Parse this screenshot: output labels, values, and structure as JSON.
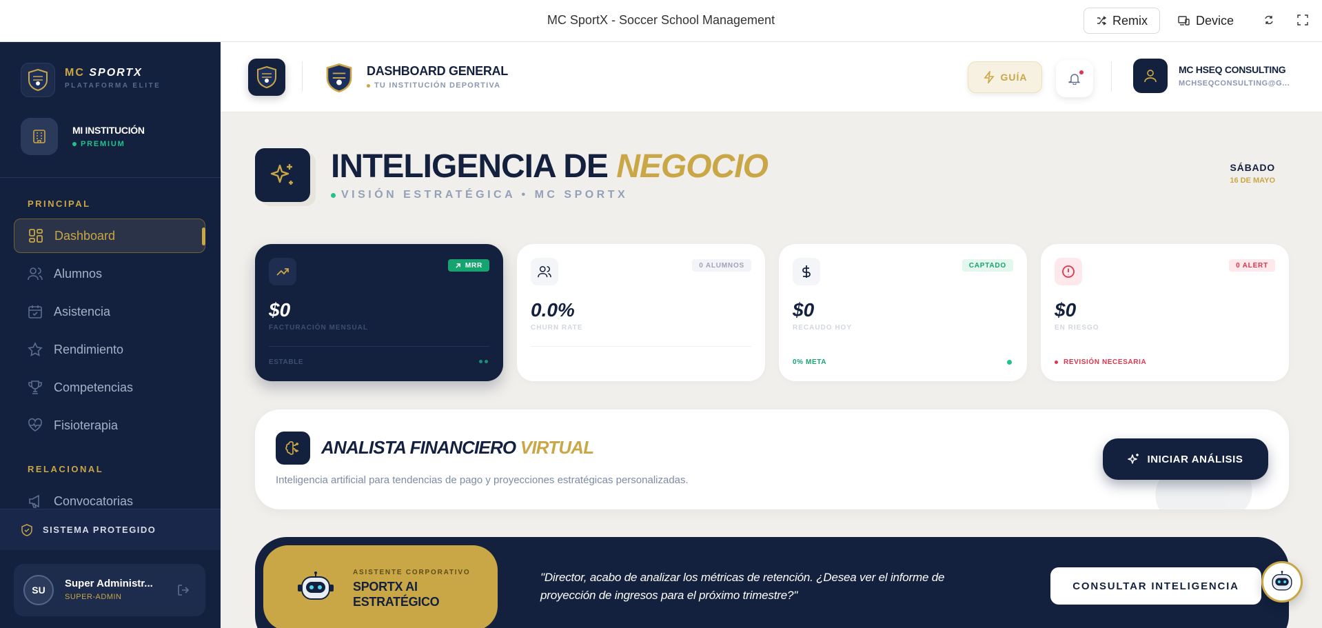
{
  "window": {
    "title": "MC SportX - Soccer School Management",
    "remix_label": "Remix",
    "device_label": "Device"
  },
  "sidebar": {
    "brand_first": "MC",
    "brand_second": "SPORTX",
    "brand_subtitle": "PLATAFORMA ELITE",
    "institution_name": "MI INSTITUCIÓN",
    "institution_tier": "PREMIUM",
    "sections": [
      {
        "label": "PRINCIPAL"
      },
      {
        "label": "RELACIONAL"
      }
    ],
    "items": [
      {
        "label": "Dashboard",
        "icon": "dashboard-icon",
        "active": true
      },
      {
        "label": "Alumnos",
        "icon": "users-icon"
      },
      {
        "label": "Asistencia",
        "icon": "calendar-check-icon"
      },
      {
        "label": "Rendimiento",
        "icon": "star-icon"
      },
      {
        "label": "Competencias",
        "icon": "trophy-icon"
      },
      {
        "label": "Fisioterapia",
        "icon": "heart-pulse-icon"
      },
      {
        "label": "Convocatorias",
        "icon": "megaphone-icon"
      }
    ],
    "protected_label": "SISTEMA PROTEGIDO",
    "user": {
      "initials": "SU",
      "name": "Super Administr...",
      "role": "SUPER-ADMIN"
    }
  },
  "header": {
    "title": "DASHBOARD GENERAL",
    "subtitle": "TU INSTITUCIÓN DEPORTIVA",
    "guide_label": "GUÍA",
    "account_name": "MC HSEQ CONSULTING",
    "account_email": "MCHSEQCONSULTING@G..."
  },
  "page": {
    "title_main": "INTELIGENCIA DE",
    "title_accent": "NEGOCIO",
    "subtitle": "VISIÓN ESTRATÉGICA • MC SPORTX",
    "day": "SÁBADO",
    "date": "16 DE MAYO"
  },
  "kpis": [
    {
      "icon": "trending-up-icon",
      "badge": "MRR",
      "value": "$0",
      "label": "FACTURACIÓN MENSUAL",
      "footer": "ESTABLE"
    },
    {
      "icon": "users-icon",
      "badge": "0 ALUMNOS",
      "value": "0.0%",
      "label": "CHURN RATE",
      "footer": ""
    },
    {
      "icon": "dollar-icon",
      "badge": "CAPTADO",
      "value": "$0",
      "label": "RECAUDO HOY",
      "footer": "0% META"
    },
    {
      "icon": "alert-circle-icon",
      "badge": "0 ALERT",
      "value": "$0",
      "label": "EN RIESGO",
      "footer": "REVISIÓN NECESARIA"
    }
  ],
  "analyst": {
    "title_main": "ANALISTA FINANCIERO",
    "title_accent": "VIRTUAL",
    "description": "Inteligencia artificial para tendencias de pago y proyecciones estratégicas personalizadas.",
    "button_label": "INICIAR ANÁLISIS"
  },
  "assistant": {
    "kicker": "ASISTENTE CORPORATIVO",
    "name": "SPORTX AI ESTRATÉGICO",
    "quote": "\"Director, acabo de analizar los métricas de retención. ¿Desea ver el informe de proyección de ingresos para el próximo trimestre?\"",
    "button_label": "CONSULTAR INTELIGENCIA"
  },
  "colors": {
    "navy": "#13213f",
    "gold": "#c9a646",
    "green": "#22c28a",
    "red": "#e0344c"
  }
}
